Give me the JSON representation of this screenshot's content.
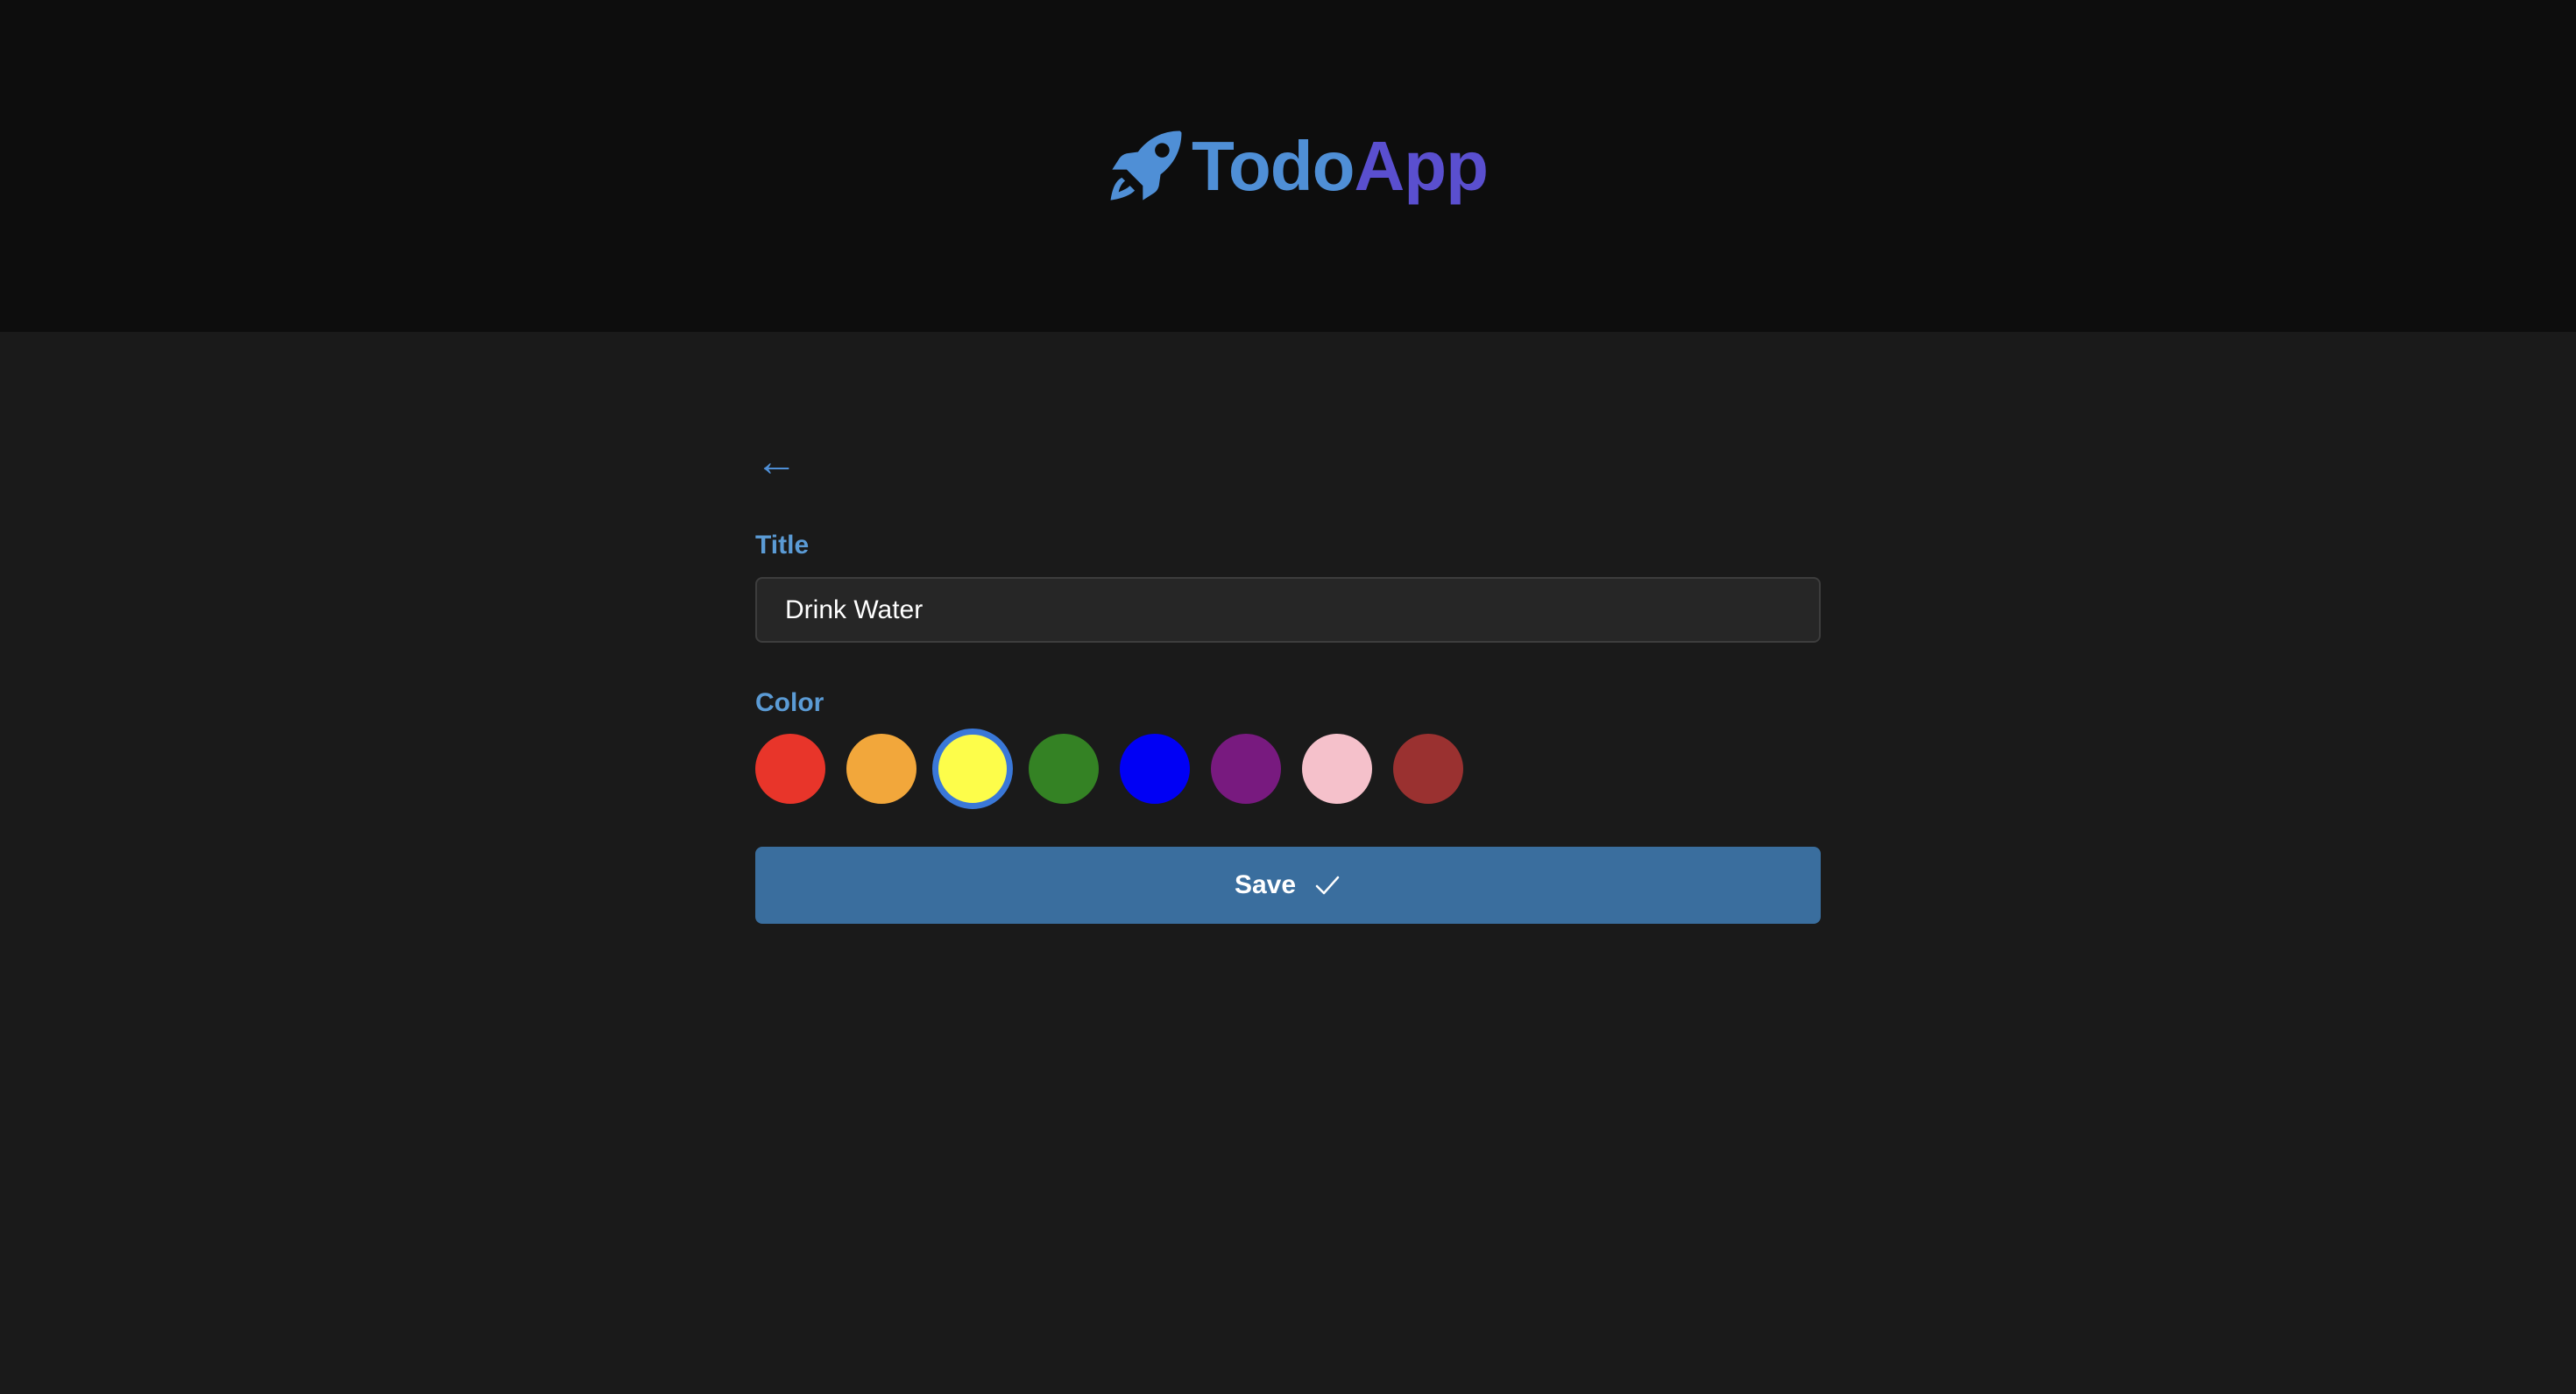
{
  "brand": {
    "part1": "Todo",
    "part2": "App",
    "icon": "rocket-icon"
  },
  "nav": {
    "back_label": "←",
    "back_icon": "arrow-left-icon"
  },
  "form": {
    "title_label": "Title",
    "title_value": "Drink Water",
    "color_label": "Color",
    "colors": [
      {
        "name": "red",
        "hex": "#e8352a",
        "selected": false
      },
      {
        "name": "orange",
        "hex": "#f2a73b",
        "selected": false
      },
      {
        "name": "yellow",
        "hex": "#fdfd4a",
        "selected": true
      },
      {
        "name": "green",
        "hex": "#348224",
        "selected": false
      },
      {
        "name": "blue",
        "hex": "#0000f5",
        "selected": false
      },
      {
        "name": "purple",
        "hex": "#781a7f",
        "selected": false
      },
      {
        "name": "pink",
        "hex": "#f5c1cb",
        "selected": false
      },
      {
        "name": "brown",
        "hex": "#9a3130",
        "selected": false
      }
    ],
    "save_label": "Save",
    "save_icon": "checkmark-icon"
  },
  "theme": {
    "accent": "#4f8fd6",
    "brand_secondary": "#5a4fcf",
    "button": "#3a6e9e",
    "header_bg": "#0d0d0d",
    "page_bg": "#1a1a1a"
  }
}
